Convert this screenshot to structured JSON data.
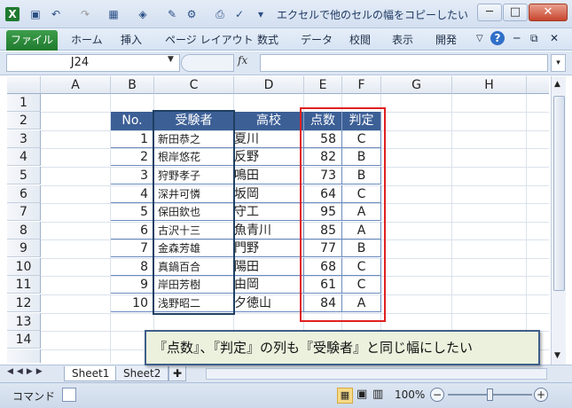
{
  "window": {
    "title": "エクセルで他のセルの幅をコピーしたい！形...",
    "buttons": {
      "help": "?",
      "minimize": "─",
      "restore": "□",
      "close": "✕"
    }
  },
  "ribbon": {
    "file_tab": "ファイル",
    "tabs": [
      "ホーム",
      "挿入",
      "ページ レイアウト",
      "数式",
      "データ",
      "校閲",
      "表示",
      "開発"
    ]
  },
  "formula_bar": {
    "name_box": "J24",
    "fx": "fx",
    "formula": ""
  },
  "columns": [
    "A",
    "B",
    "C",
    "D",
    "E",
    "F",
    "G",
    "H"
  ],
  "rows": [
    "1",
    "2",
    "3",
    "4",
    "5",
    "6",
    "7",
    "8",
    "9",
    "10",
    "11",
    "12",
    "13",
    "14"
  ],
  "table": {
    "headers": {
      "no": "No.",
      "examinee": "受験者",
      "school": "高校",
      "score": "点数",
      "grade": "判定"
    },
    "rows": [
      {
        "no": "1",
        "name": "新田恭之",
        "school": "夏川",
        "score": "58",
        "grade": "C"
      },
      {
        "no": "2",
        "name": "根岸悠花",
        "school": "反野",
        "score": "82",
        "grade": "B"
      },
      {
        "no": "3",
        "name": "狩野孝子",
        "school": "鳴田",
        "score": "73",
        "grade": "B"
      },
      {
        "no": "4",
        "name": "深井可憐",
        "school": "坂岡",
        "score": "64",
        "grade": "C"
      },
      {
        "no": "5",
        "name": "保田欽也",
        "school": "守工",
        "score": "95",
        "grade": "A"
      },
      {
        "no": "6",
        "name": "古沢十三",
        "school": "魚青川",
        "score": "85",
        "grade": "A"
      },
      {
        "no": "7",
        "name": "金森芳雄",
        "school": "門野",
        "score": "77",
        "grade": "B"
      },
      {
        "no": "8",
        "name": "真鍋百合",
        "school": "陽田",
        "score": "68",
        "grade": "C"
      },
      {
        "no": "9",
        "name": "岸田芳樹",
        "school": "由岡",
        "score": "61",
        "grade": "C"
      },
      {
        "no": "10",
        "name": "浅野昭二",
        "school": "夕徳山",
        "score": "84",
        "grade": "A"
      }
    ]
  },
  "callout": "『点数』、『判定』の列も『受験者』と同じ幅にしたい",
  "sheets": [
    "Sheet1",
    "Sheet2"
  ],
  "status": {
    "mode": "コマンド",
    "zoom": "100%"
  },
  "colors": {
    "header_fill": "#3c5f96",
    "highlight_red": "#e02020",
    "highlight_navy": "#1f3f63",
    "excel_green": "#1f7a2f"
  }
}
